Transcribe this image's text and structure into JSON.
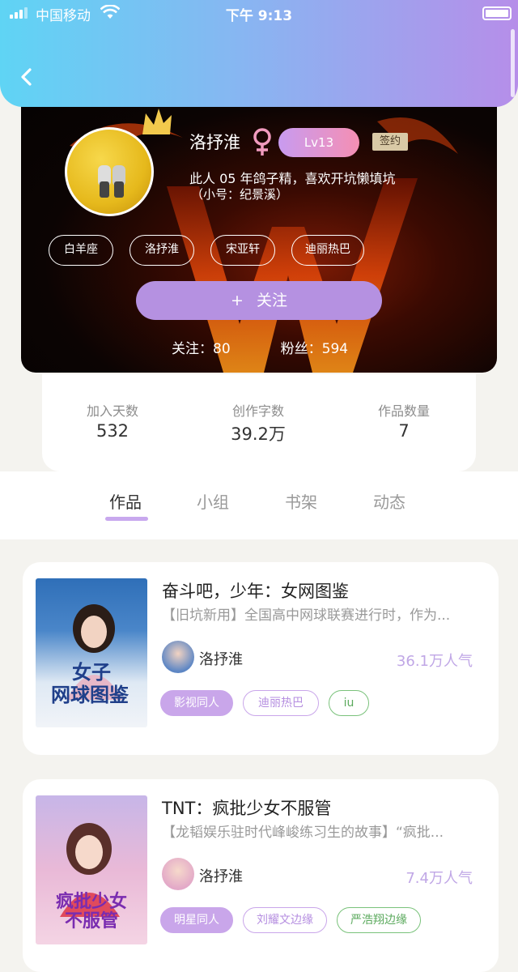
{
  "status_bar": {
    "carrier": "中国移动",
    "time": "下午 9:13"
  },
  "profile": {
    "name": "洛抒淮",
    "level": "Lv13",
    "signed_badge": "签约",
    "bio_line1": "此人 05 年鸽子精，喜欢开坑懒填坑",
    "bio_line2": "（小号：纪景溪）",
    "tags": [
      "白羊座",
      "洛抒淮",
      "宋亚轩",
      "迪丽热巴"
    ],
    "follow_label": "关注",
    "following": "关注：80",
    "fans": "粉丝：594"
  },
  "stats": [
    {
      "label": "加入天数",
      "value": "532"
    },
    {
      "label": "创作字数",
      "value": "39.2万"
    },
    {
      "label": "作品数量",
      "value": "7"
    }
  ],
  "tabs": [
    {
      "label": "作品",
      "active": true
    },
    {
      "label": "小组",
      "active": false
    },
    {
      "label": "书架",
      "active": false
    },
    {
      "label": "动态",
      "active": false
    }
  ],
  "works": [
    {
      "title": "奋斗吧，少年：女网图鉴",
      "description": "【旧坑新用】全国高中网球联赛进行时，作为...",
      "author": "洛抒淮",
      "popularity": "36.1万人气",
      "tags": [
        "影视同人",
        "迪丽热巴",
        "iu"
      ],
      "cover_title": "女子网球图鉴"
    },
    {
      "title": "TNT：疯批少女不服管",
      "description": "【龙韬娱乐驻时代峰峻练习生的故事】“疯批...",
      "author": "洛抒淮",
      "popularity": "7.4万人气",
      "tags": [
        "明星同人",
        "刘耀文边缘",
        "严浩翔边缘"
      ],
      "cover_title": "疯批少女不服管"
    }
  ],
  "colors": {
    "accent": "#c9a6ea",
    "header_start": "#5fd4f4",
    "header_end": "#b68ee9"
  }
}
